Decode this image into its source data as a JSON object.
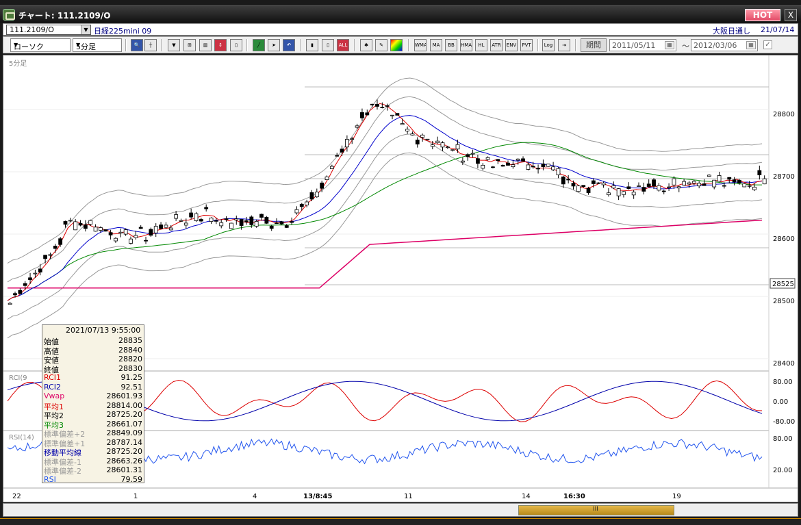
{
  "window": {
    "title": "チャート: 111.2109/O",
    "hot_label": "HOT",
    "close_label": "X"
  },
  "infobar": {
    "symbol": "111.2109/O",
    "instrument": "日経225mini 09",
    "market": "大阪日通し",
    "date": "21/07/14"
  },
  "toolbar": {
    "chart_type": "ローソク",
    "interval": "5分足",
    "indicator_buttons": [
      "WMA",
      "MA",
      "BB",
      "HMA",
      "HL",
      "ATR",
      "ENV",
      "PVT"
    ],
    "log_label": "Log",
    "period_label": "期間",
    "date_from": "2011/05/11",
    "date_to": "2012/03/06",
    "tilde": "～",
    "all_label": "ALL"
  },
  "chart": {
    "main_label": "5分足",
    "price_ticks": [
      "28800",
      "28700",
      "28600",
      "28500",
      "28400"
    ],
    "current_price_label": "28525",
    "rci_label": "RCI(9",
    "rci_ticks": [
      "80.00",
      "0.00",
      "-80.00"
    ],
    "rsi_label": "RSI(14)",
    "rsi_ticks": [
      "80.00",
      "20.00"
    ],
    "x_labels": [
      "22",
      "1",
      "4",
      "13/8:45",
      "11",
      "14",
      "16:30",
      "19"
    ],
    "bold_x_labels": [
      "13/8:45",
      "16:30"
    ],
    "colors": {
      "candle": "#000000",
      "ma1": "#dd0000",
      "ma2": "#0000cc",
      "ma3": "#008800",
      "vwap": "#dd0066",
      "band": "#999999",
      "rci1": "#dd0000",
      "rci2": "#0000aa",
      "rsi": "#2255ee"
    }
  },
  "info_box": {
    "datetime": "2021/07/13 9:55:00",
    "rows": [
      {
        "label": "始値",
        "value": "28835",
        "color": "#000000"
      },
      {
        "label": "高値",
        "value": "28840",
        "color": "#000000"
      },
      {
        "label": "安値",
        "value": "28820",
        "color": "#000000"
      },
      {
        "label": "終値",
        "value": "28830",
        "color": "#000000"
      },
      {
        "label": "RCI1",
        "value": "91.25",
        "color": "#dd0000"
      },
      {
        "label": "RCI2",
        "value": "92.51",
        "color": "#0000aa"
      },
      {
        "label": "Vwap",
        "value": "28601.93",
        "color": "#dd0066"
      },
      {
        "label": "平均1",
        "value": "28814.00",
        "color": "#dd0000"
      },
      {
        "label": "平均2",
        "value": "28725.20",
        "color": "#000000"
      },
      {
        "label": "平均3",
        "value": "28661.07",
        "color": "#008800"
      },
      {
        "label": "標準偏差+2",
        "value": "28849.09",
        "color": "#999999"
      },
      {
        "label": "標準偏差+1",
        "value": "28787.14",
        "color": "#999999"
      },
      {
        "label": "移動平均線",
        "value": "28725.20",
        "color": "#0000aa"
      },
      {
        "label": "標準偏差-1",
        "value": "28663.26",
        "color": "#999999"
      },
      {
        "label": "標準偏差-2",
        "value": "28601.31",
        "color": "#999999"
      },
      {
        "label": "RSI",
        "value": "79.59",
        "color": "#2255ee"
      }
    ]
  },
  "scrollbar": {
    "thumb_label": "III"
  }
}
